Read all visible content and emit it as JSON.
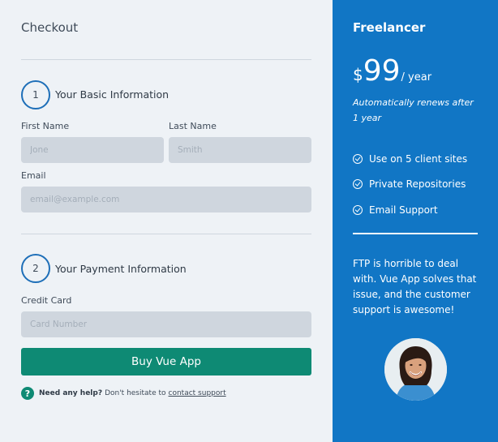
{
  "checkout": {
    "title": "Checkout",
    "step1": {
      "number": "1",
      "label": "Your Basic Information"
    },
    "first_name": {
      "label": "First Name",
      "placeholder": "Jone"
    },
    "last_name": {
      "label": "Last Name",
      "placeholder": "Smith"
    },
    "email": {
      "label": "Email",
      "placeholder": "email@example.com"
    },
    "step2": {
      "number": "2",
      "label": "Your Payment Information"
    },
    "credit_card": {
      "label": "Credit Card",
      "placeholder": "Card Number"
    },
    "buy_label": "Buy Vue App",
    "help": {
      "icon": "?",
      "bold": "Need any help?",
      "text": "Don't hesitate to",
      "link": "contact support"
    }
  },
  "plan": {
    "name": "Freelancer",
    "currency": "$",
    "amount": "99",
    "period": "/ year",
    "renewal": "Automatically renews after 1 year",
    "features": [
      {
        "icon": "check-circle-icon",
        "label": "Use on 5 client sites"
      },
      {
        "icon": "check-circle-icon",
        "label": "Private Repositories"
      },
      {
        "icon": "check-circle-icon",
        "label": "Email Support"
      }
    ],
    "testimonial": "FTP is horrible to deal with. Vue App solves that issue, and the customer support is awesome!"
  },
  "colors": {
    "accent_blue": "#1176c5",
    "button_green": "#0e8a74",
    "background": "#eef2f6",
    "input_bg": "#cfd6de"
  }
}
